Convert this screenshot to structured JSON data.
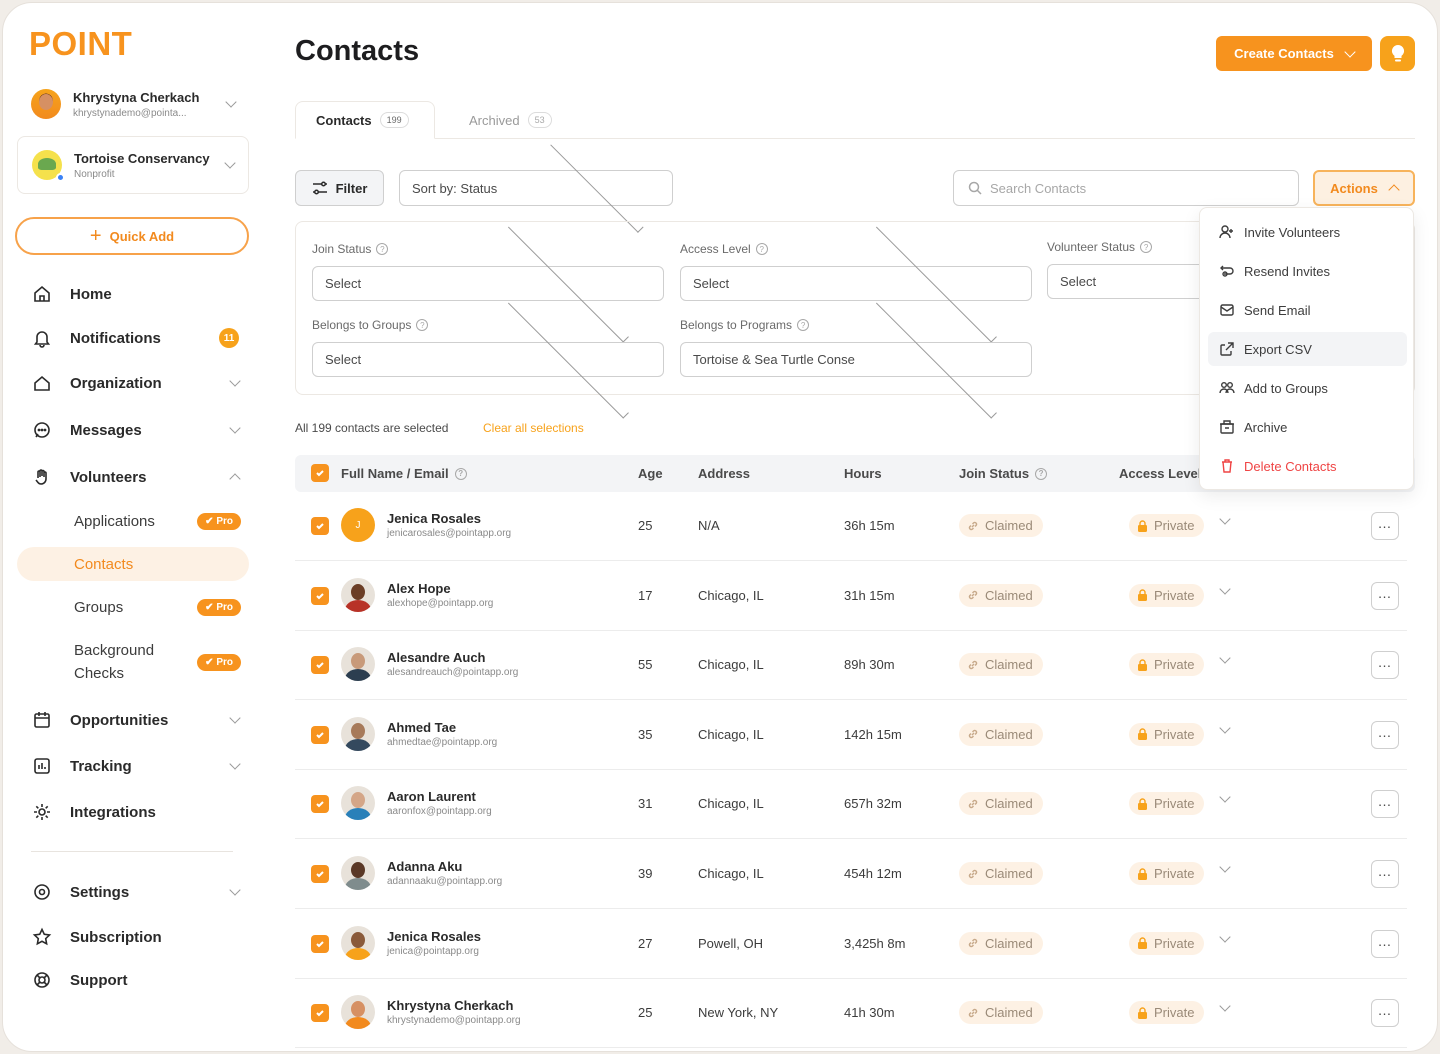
{
  "app": {
    "logo": "POINT"
  },
  "user": {
    "name": "Khrystyna Cherkach",
    "email": "khrystynademo@pointa..."
  },
  "org": {
    "name": "Tortoise Conservancy",
    "type": "Nonprofit"
  },
  "quick_add": {
    "label": "Quick Add"
  },
  "nav": {
    "home": "Home",
    "notifications": "Notifications",
    "notifications_count": "11",
    "organization": "Organization",
    "messages": "Messages",
    "volunteers": "Volunteers",
    "applications": "Applications",
    "contacts": "Contacts",
    "groups": "Groups",
    "background_checks": "Background Checks",
    "opportunities": "Opportunities",
    "tracking": "Tracking",
    "integrations": "Integrations",
    "settings": "Settings",
    "subscription": "Subscription",
    "support": "Support",
    "pro_badge": "Pro"
  },
  "page": {
    "title": "Contacts",
    "create_label": "Create Contacts"
  },
  "tabs": [
    {
      "label": "Contacts",
      "count": "199"
    },
    {
      "label": "Archived",
      "count": "53"
    }
  ],
  "toolbar": {
    "filter_label": "Filter",
    "sort_label": "Sort by: Status",
    "search_placeholder": "Search Contacts",
    "actions_label": "Actions"
  },
  "filters": {
    "join_status": {
      "label": "Join Status",
      "value": "Select"
    },
    "access_level": {
      "label": "Access Level",
      "value": "Select"
    },
    "volunteer_status": {
      "label": "Volunteer Status",
      "value": "Select"
    },
    "groups": {
      "label": "Belongs to Groups",
      "value": "Select"
    },
    "programs": {
      "label": "Belongs to Programs",
      "value": "Tortoise & Sea Turtle Conservation"
    }
  },
  "selection": {
    "info": "All 199 contacts are selected",
    "clear": "Clear all selections"
  },
  "table": {
    "headers": {
      "name": "Full Name / Email",
      "age": "Age",
      "address": "Address",
      "hours": "Hours",
      "join": "Join Status",
      "access": "Access Level"
    },
    "rows": [
      {
        "initial": "J",
        "name": "Jenica Rosales",
        "email": "jenicarosales@pointapp.org",
        "age": "25",
        "address": "N/A",
        "hours": "36h 15m",
        "join": "Claimed",
        "access": "Private"
      },
      {
        "name": "Alex Hope",
        "email": "alexhope@pointapp.org",
        "age": "17",
        "address": "Chicago, IL",
        "hours": "31h 15m",
        "join": "Claimed",
        "access": "Private"
      },
      {
        "name": "Alesandre Auch",
        "email": "alesandreauch@pointapp.org",
        "age": "55",
        "address": "Chicago, IL",
        "hours": "89h 30m",
        "join": "Claimed",
        "access": "Private"
      },
      {
        "name": "Ahmed Tae",
        "email": "ahmedtae@pointapp.org",
        "age": "35",
        "address": "Chicago, IL",
        "hours": "142h 15m",
        "join": "Claimed",
        "access": "Private"
      },
      {
        "name": "Aaron Laurent",
        "email": "aaronfox@pointapp.org",
        "age": "31",
        "address": "Chicago, IL",
        "hours": "657h 32m",
        "join": "Claimed",
        "access": "Private"
      },
      {
        "name": "Adanna Aku",
        "email": "adannaaku@pointapp.org",
        "age": "39",
        "address": "Chicago, IL",
        "hours": "454h 12m",
        "join": "Claimed",
        "access": "Private"
      },
      {
        "name": "Jenica Rosales",
        "email": "jenica@pointapp.org",
        "age": "27",
        "address": "Powell, OH",
        "hours": "3,425h 8m",
        "join": "Claimed",
        "access": "Private"
      },
      {
        "name": "Khrystyna Cherkach",
        "email": "khrystynademo@pointapp.org",
        "age": "25",
        "address": "New York, NY",
        "hours": "41h 30m",
        "join": "Claimed",
        "access": "Private"
      }
    ]
  },
  "actions_menu": [
    {
      "label": "Invite Volunteers",
      "icon": "user-plus-icon"
    },
    {
      "label": "Resend Invites",
      "icon": "resend-icon"
    },
    {
      "label": "Send Email",
      "icon": "mail-icon"
    },
    {
      "label": "Export CSV",
      "icon": "export-icon"
    },
    {
      "label": "Add to Groups",
      "icon": "users-icon"
    },
    {
      "label": "Archive",
      "icon": "archive-icon"
    },
    {
      "label": "Delete Contacts",
      "icon": "trash-icon"
    }
  ],
  "colors": {
    "accent": "#f7931e",
    "danger": "#ef4444"
  }
}
